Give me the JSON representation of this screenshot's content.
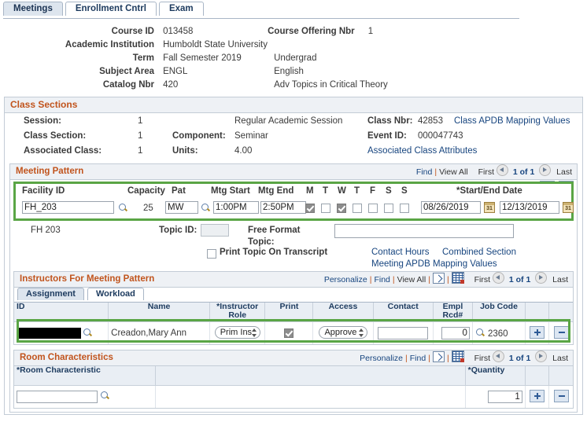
{
  "tabs": [
    {
      "label": "Meetings",
      "active": true
    },
    {
      "label": "Enrollment Cntrl",
      "active": false
    },
    {
      "label": "Exam",
      "active": false
    }
  ],
  "key_fields": {
    "course_id_label": "Course ID",
    "course_id_value": "013458",
    "course_offering_nbr_label": "Course Offering Nbr",
    "course_offering_nbr_value": "1",
    "academic_institution_label": "Academic Institution",
    "academic_institution_value": "Humboldt State University",
    "term_label": "Term",
    "term_value": "Fall Semester 2019",
    "term_career": "Undergrad",
    "subject_area_label": "Subject Area",
    "subject_area_value": "ENGL",
    "subject_area_descr": "English",
    "catalog_nbr_label": "Catalog Nbr",
    "catalog_nbr_value": "420",
    "catalog_descr": "Adv Topics in Critical Theory"
  },
  "class_sections": {
    "title": "Class Sections",
    "session_label": "Session:",
    "session_value": "1",
    "session_descr": "Regular Academic Session",
    "class_section_label": "Class Section:",
    "class_section_value": "1",
    "component_label": "Component:",
    "component_value": "Seminar",
    "associated_class_label": "Associated Class:",
    "associated_class_value": "1",
    "units_label": "Units:",
    "units_value": "4.00",
    "class_nbr_label": "Class Nbr:",
    "class_nbr_value": "42853",
    "class_apdb_link": "Class APDB Mapping Values",
    "event_id_label": "Event ID:",
    "event_id_value": "000047743",
    "assoc_class_attr_link": "Associated Class Attributes"
  },
  "meeting_pattern": {
    "title": "Meeting Pattern",
    "nav": {
      "find": "Find",
      "view_all": "View All",
      "first": "First",
      "count": "1 of 1",
      "last": "Last"
    },
    "headers": {
      "facility_id": "Facility ID",
      "capacity": "Capacity",
      "pat": "Pat",
      "mtg_start": "Mtg Start",
      "mtg_end": "Mtg End",
      "start_end_date": "*Start/End Date",
      "days": [
        "M",
        "T",
        "W",
        "T",
        "F",
        "S",
        "S"
      ]
    },
    "row": {
      "facility_id": "FH_203",
      "capacity": "25",
      "pat": "MW",
      "mtg_start": "1:00PM",
      "mtg_end": "2:50PM",
      "days_checked": [
        true,
        false,
        true,
        false,
        false,
        false,
        false
      ],
      "start_date": "08/26/2019",
      "end_date": "12/13/2019"
    },
    "facility_descr": "FH  203",
    "topic_id_label": "Topic ID:",
    "topic_id_value": "",
    "free_format_topic_label": "Free Format Topic:",
    "free_format_topic_value": "",
    "print_topic_label": "Print Topic On Transcript",
    "print_topic_checked": false,
    "contact_hours_link": "Contact Hours",
    "combined_section_link": "Combined Section",
    "meeting_apdb_link": "Meeting APDB Mapping Values"
  },
  "instructors": {
    "title": "Instructors For Meeting Pattern",
    "nav": {
      "personalize": "Personalize",
      "find": "Find",
      "view_all": "View All",
      "first": "First",
      "count": "1 of 1",
      "last": "Last"
    },
    "subtabs": [
      {
        "label": "Assignment",
        "active": true
      },
      {
        "label": "Workload",
        "active": false
      }
    ],
    "columns": [
      "ID",
      "Name",
      "*Instructor Role",
      "Print",
      "Access",
      "Contact",
      "Empl Rcd#",
      "Job Code"
    ],
    "rows": [
      {
        "id": "",
        "name": "Creadon,Mary Ann",
        "instructor_role": "Prim Ins",
        "print_checked": true,
        "access": "Approve",
        "contact": "",
        "empl_rcd": "0",
        "job_code": "2360"
      }
    ]
  },
  "room_characteristics": {
    "title": "Room Characteristics",
    "nav": {
      "personalize": "Personalize",
      "find": "Find",
      "first": "First",
      "count": "1 of 1",
      "last": "Last"
    },
    "columns": [
      "*Room Characteristic",
      "*Quantity"
    ],
    "rows": [
      {
        "room_characteristic": "",
        "quantity": "1"
      }
    ]
  },
  "colors": {
    "accent_orange": "#c1541d",
    "link_blue": "#17457f",
    "highlight_green": "#5aa545",
    "header_bg": "#eef1f5"
  }
}
